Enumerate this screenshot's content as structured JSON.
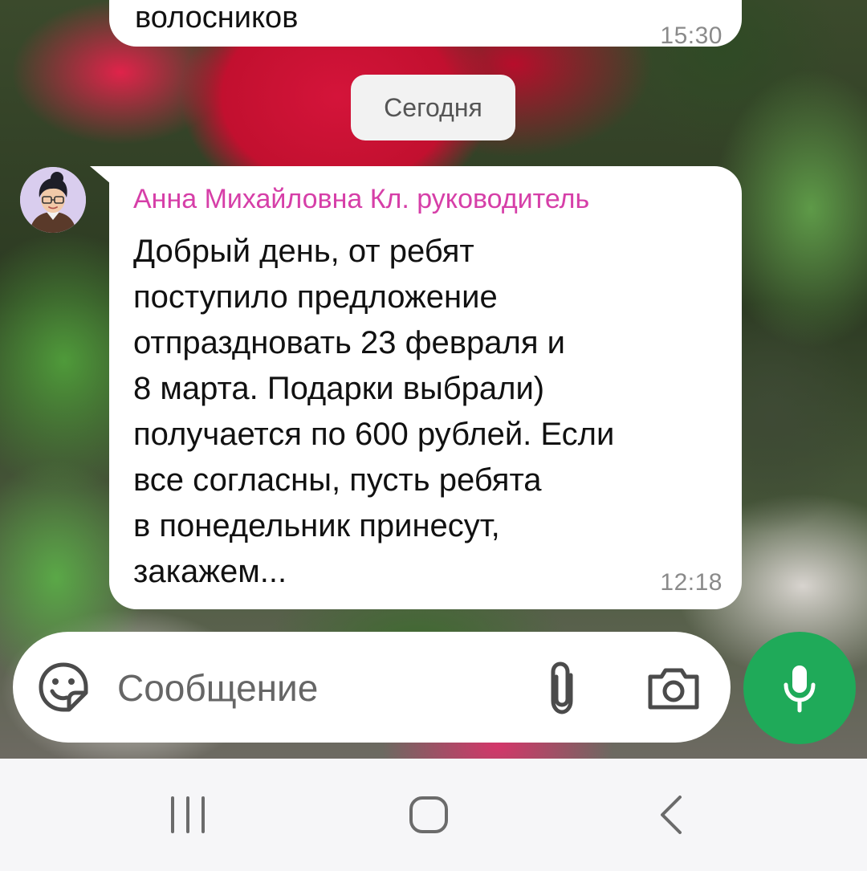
{
  "chat": {
    "previous_message": {
      "text": "волосников",
      "time": "15:30"
    },
    "date_separator": "Сегодня",
    "message": {
      "sender": "Анна Михайловна Кл. руководитель",
      "text": "Добрый день, от ребят\nпоступило предложение\nотпраздновать 23 февраля и\n8 марта. Подарки выбрали)\nполучается по 600 рублей. Если\nвсе согласны, пусть ребята\nв понедельник принесут,\nзакажем...",
      "time": "12:18"
    }
  },
  "composer": {
    "placeholder": "Сообщение",
    "icons": {
      "sticker": "sticker-icon",
      "attach": "paperclip-icon",
      "camera": "camera-icon",
      "mic": "microphone-icon"
    },
    "mic_color": "#1faa59"
  },
  "navbar": {
    "icons": [
      "recents-icon",
      "home-icon",
      "back-icon"
    ]
  },
  "colors": {
    "sender_name": "#d63fa8",
    "bubble": "#ffffff"
  }
}
